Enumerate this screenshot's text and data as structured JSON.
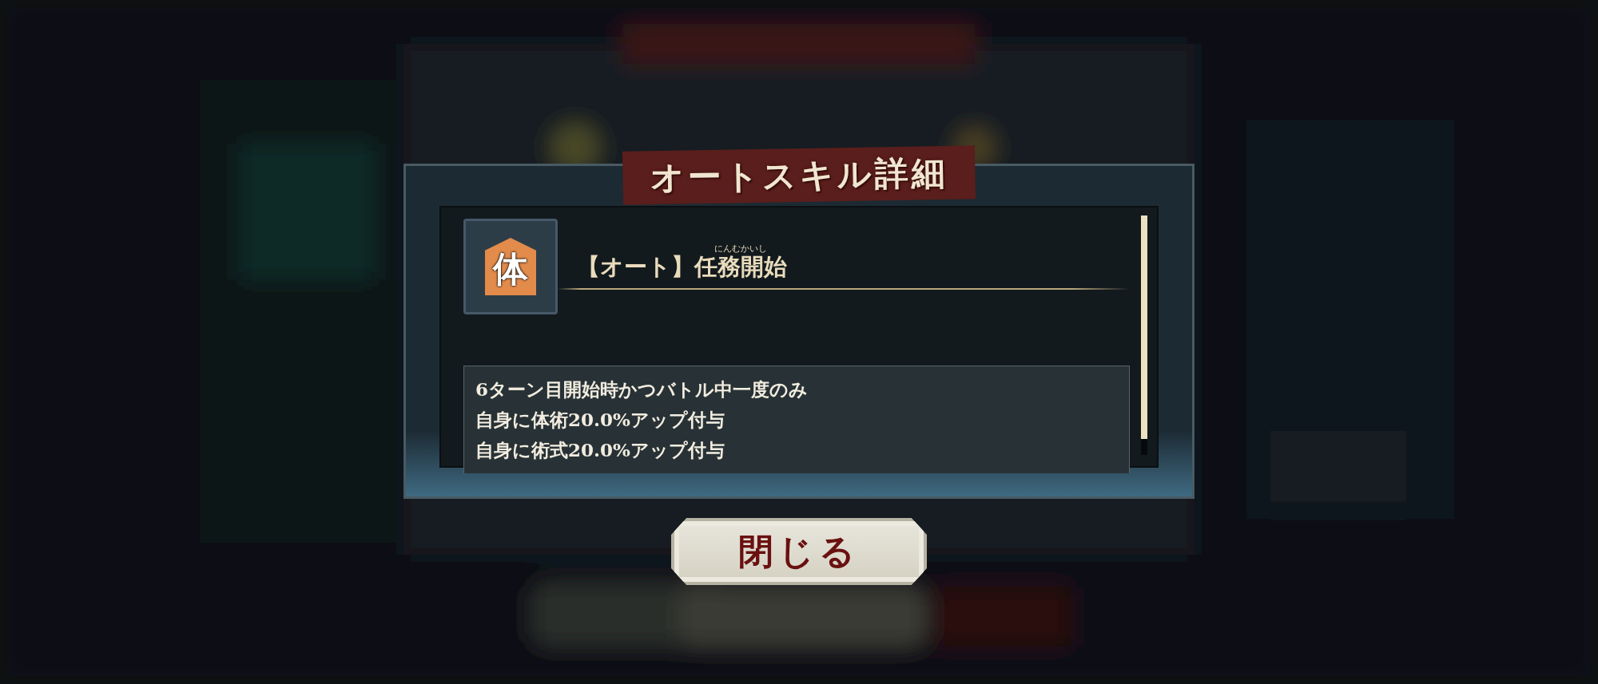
{
  "dialog": {
    "title": "オートスキル詳細",
    "skill": {
      "icon_glyph": "体",
      "prefix": "【オート】",
      "name": "任務開始",
      "ruby": "にんむかいし"
    },
    "description": [
      "6ターン目開始時かつバトル中一度のみ",
      "自身に体術20.0%アップ付与",
      "自身に術式20.0%アップ付与"
    ]
  },
  "buttons": [
    {
      "label": "閉じる"
    }
  ]
}
